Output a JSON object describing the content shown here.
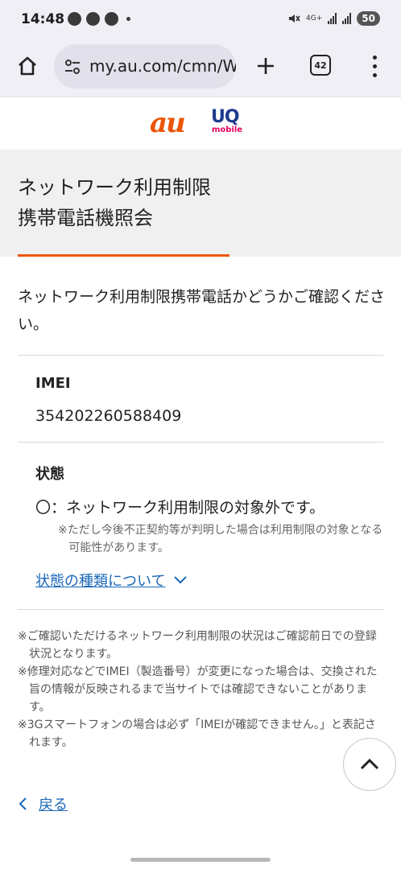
{
  "status_bar": {
    "time": "14:48",
    "network": "4G+",
    "battery": "50"
  },
  "browser": {
    "url": "my.au.com/cmn/W",
    "tab_count": "42",
    "icons": [
      "home-icon",
      "site-settings-icon",
      "plus-icon",
      "tab-switcher-icon",
      "more-vert-icon"
    ]
  },
  "logos": {
    "au": "au",
    "uq": "UQ",
    "uq_sub": "mobile"
  },
  "page": {
    "title_line1": "ネットワーク利用制限",
    "title_line2": "携帯電話機照会",
    "intro": "ネットワーク利用制限携帯電話かどうかご確認ください。"
  },
  "imei": {
    "label": "IMEI",
    "value": "354202260588409"
  },
  "status": {
    "label": "状態",
    "value": "〇：ネットワーク利用制限の対象外です。",
    "note": "※ただし今後不正契約等が判明した場合は利用制限の対象となる可能性があります。",
    "types_link": "状態の種類について"
  },
  "footnotes": [
    "※ご確認いただけるネットワーク利用制限の状況はご確認前日での登録状況となります。",
    "※修理対応などでIMEI（製造番号）が変更になった場合は、交換された旨の情報が反映されるまで当サイトでは確認できないことがあります。",
    "※3Gスマートフォンの場合は必ず「IMEIが確認できません。」と表記されます。"
  ],
  "back": {
    "label": "戻る"
  },
  "colors": {
    "accent": "#eb5505",
    "link": "#1a68b8",
    "title_bg": "#f0f0f0"
  }
}
